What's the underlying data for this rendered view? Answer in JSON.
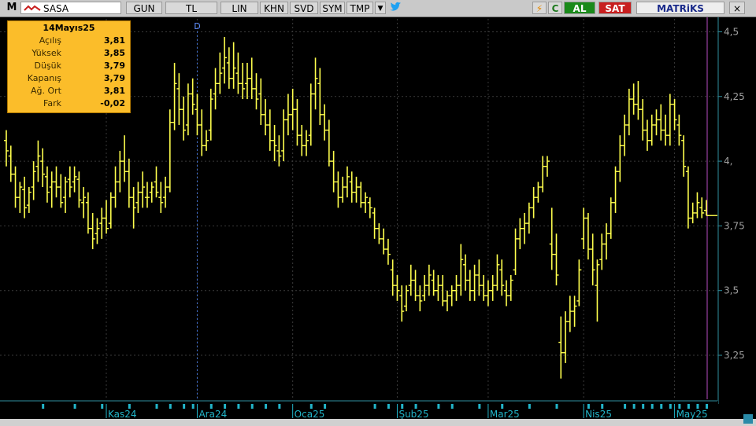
{
  "toolbar": {
    "m_label": "M",
    "symbol": "SASA",
    "gun": "GUN",
    "tl": "TL",
    "lin": "LIN",
    "khn": "KHN",
    "svd": "SVD",
    "sym": "SYM",
    "tmp": "TMP",
    "dropdown": "▼",
    "twitter_icon": "twitter-icon",
    "bolt_icon": "⚡",
    "refresh_label": "C",
    "al": "AL",
    "sat": "SAT",
    "matriks": "MATRiKS",
    "close": "×"
  },
  "info": {
    "date": "14Mayıs25",
    "rows": [
      {
        "label": "Açılış",
        "value": "3,81"
      },
      {
        "label": "Yüksek",
        "value": "3,85"
      },
      {
        "label": "Düşük",
        "value": "3,79"
      },
      {
        "label": "Kapanış",
        "value": "3,79"
      },
      {
        "label": "Ağ. Ort",
        "value": "3,81"
      },
      {
        "label": "Fark",
        "value": "-0,02"
      }
    ]
  },
  "colors": {
    "bar": "#ffff4d",
    "grid": "#3a3a3a",
    "axis_text": "#a0a0a0",
    "month_text": "#22b5c9",
    "marker": "#22b5c9",
    "cursor": "#b84dc2",
    "divider": "#2f8fa0"
  },
  "chart_data": {
    "type": "ohlc",
    "ylim": [
      3.08,
      4.55
    ],
    "yticks": [
      {
        "v": 4.5,
        "label": "4,5"
      },
      {
        "v": 4.25,
        "label": "4,25"
      },
      {
        "v": 4.0,
        "label": "4,"
      },
      {
        "v": 3.75,
        "label": "3,75"
      },
      {
        "v": 3.5,
        "label": "3,5"
      },
      {
        "v": 3.25,
        "label": "3,25"
      }
    ],
    "months": [
      {
        "label": "Kas24",
        "index": 22
      },
      {
        "label": "Ara24",
        "index": 42
      },
      {
        "label": "Oca25",
        "index": 63
      },
      {
        "label": "Şub25",
        "index": 86
      },
      {
        "label": "Mar25",
        "index": 106
      },
      {
        "label": "Nis25",
        "index": 127
      },
      {
        "label": "May25",
        "index": 147
      }
    ],
    "dividend_marker": {
      "label": "D",
      "index": 42
    },
    "markers": [
      8,
      15,
      21,
      27,
      33,
      36,
      39,
      41,
      45,
      48,
      51,
      54,
      57,
      60,
      67,
      70,
      81,
      84,
      87,
      90,
      95,
      98,
      104,
      109,
      115,
      121,
      128,
      131,
      136,
      138,
      140,
      142,
      144,
      146,
      148,
      150,
      152,
      154
    ],
    "ohlc": [
      [
        4.08,
        4.12,
        3.98,
        4.04
      ],
      [
        4.02,
        4.06,
        3.92,
        3.95
      ],
      [
        3.95,
        3.98,
        3.82,
        3.86
      ],
      [
        3.86,
        3.92,
        3.8,
        3.9
      ],
      [
        3.89,
        3.94,
        3.78,
        3.82
      ],
      [
        3.83,
        3.9,
        3.8,
        3.88
      ],
      [
        3.9,
        4.0,
        3.85,
        3.96
      ],
      [
        3.98,
        4.08,
        3.92,
        4.02
      ],
      [
        4.0,
        4.05,
        3.9,
        3.95
      ],
      [
        3.94,
        3.98,
        3.84,
        3.88
      ],
      [
        3.9,
        3.96,
        3.82,
        3.92
      ],
      [
        3.92,
        3.98,
        3.86,
        3.9
      ],
      [
        3.9,
        3.95,
        3.82,
        3.84
      ],
      [
        3.86,
        3.94,
        3.8,
        3.92
      ],
      [
        3.93,
        3.98,
        3.86,
        3.9
      ],
      [
        3.92,
        3.98,
        3.88,
        3.94
      ],
      [
        3.93,
        3.96,
        3.82,
        3.85
      ],
      [
        3.84,
        3.9,
        3.78,
        3.86
      ],
      [
        3.84,
        3.88,
        3.72,
        3.74
      ],
      [
        3.74,
        3.8,
        3.66,
        3.7
      ],
      [
        3.72,
        3.78,
        3.68,
        3.74
      ],
      [
        3.76,
        3.82,
        3.7,
        3.78
      ],
      [
        3.78,
        3.85,
        3.72,
        3.74
      ],
      [
        3.76,
        3.88,
        3.74,
        3.86
      ],
      [
        3.86,
        3.98,
        3.82,
        3.92
      ],
      [
        3.92,
        4.04,
        3.88,
        4.0
      ],
      [
        4.0,
        4.1,
        3.92,
        3.96
      ],
      [
        3.96,
        4.01,
        3.82,
        3.86
      ],
      [
        3.86,
        3.9,
        3.74,
        3.82
      ],
      [
        3.84,
        3.92,
        3.8,
        3.88
      ],
      [
        3.88,
        3.96,
        3.82,
        3.9
      ],
      [
        3.86,
        3.92,
        3.82,
        3.86
      ],
      [
        3.88,
        3.92,
        3.84,
        3.9
      ],
      [
        3.92,
        3.98,
        3.86,
        3.88
      ],
      [
        3.86,
        3.92,
        3.8,
        3.84
      ],
      [
        3.86,
        3.94,
        3.82,
        3.9
      ],
      [
        3.9,
        4.2,
        3.88,
        4.15
      ],
      [
        4.15,
        4.38,
        4.12,
        4.3
      ],
      [
        4.28,
        4.34,
        4.14,
        4.2
      ],
      [
        4.2,
        4.25,
        4.08,
        4.12
      ],
      [
        4.14,
        4.3,
        4.1,
        4.26
      ],
      [
        4.26,
        4.32,
        4.18,
        4.22
      ],
      [
        4.2,
        4.26,
        4.1,
        4.14
      ],
      [
        4.14,
        4.2,
        4.02,
        4.06
      ],
      [
        4.06,
        4.12,
        4.04,
        4.08
      ],
      [
        4.12,
        4.28,
        4.08,
        4.24
      ],
      [
        4.26,
        4.36,
        4.2,
        4.3
      ],
      [
        4.3,
        4.42,
        4.26,
        4.34
      ],
      [
        4.36,
        4.48,
        4.3,
        4.4
      ],
      [
        4.38,
        4.44,
        4.28,
        4.32
      ],
      [
        4.32,
        4.46,
        4.28,
        4.36
      ],
      [
        4.34,
        4.42,
        4.26,
        4.3
      ],
      [
        4.3,
        4.38,
        4.24,
        4.28
      ],
      [
        4.3,
        4.38,
        4.24,
        4.32
      ],
      [
        4.32,
        4.4,
        4.24,
        4.28
      ],
      [
        4.28,
        4.34,
        4.2,
        4.24
      ],
      [
        4.26,
        4.32,
        4.14,
        4.18
      ],
      [
        4.18,
        4.24,
        4.1,
        4.14
      ],
      [
        4.14,
        4.2,
        4.04,
        4.08
      ],
      [
        4.08,
        4.14,
        4.0,
        4.06
      ],
      [
        4.04,
        4.1,
        3.98,
        4.02
      ],
      [
        4.04,
        4.2,
        4.0,
        4.16
      ],
      [
        4.16,
        4.26,
        4.1,
        4.18
      ],
      [
        4.18,
        4.28,
        4.12,
        4.2
      ],
      [
        4.2,
        4.24,
        4.06,
        4.1
      ],
      [
        4.1,
        4.14,
        4.02,
        4.06
      ],
      [
        4.06,
        4.12,
        4.02,
        4.08
      ],
      [
        4.1,
        4.3,
        4.06,
        4.26
      ],
      [
        4.26,
        4.4,
        4.2,
        4.32
      ],
      [
        4.3,
        4.36,
        4.14,
        4.18
      ],
      [
        4.18,
        4.22,
        4.08,
        4.12
      ],
      [
        4.12,
        4.16,
        3.98,
        4.0
      ],
      [
        4.0,
        4.04,
        3.88,
        3.92
      ],
      [
        3.92,
        3.96,
        3.82,
        3.86
      ],
      [
        3.86,
        3.94,
        3.84,
        3.9
      ],
      [
        3.9,
        3.98,
        3.86,
        3.94
      ],
      [
        3.92,
        3.96,
        3.84,
        3.88
      ],
      [
        3.88,
        3.94,
        3.84,
        3.9
      ],
      [
        3.9,
        3.92,
        3.82,
        3.84
      ],
      [
        3.84,
        3.88,
        3.8,
        3.86
      ],
      [
        3.84,
        3.86,
        3.78,
        3.82
      ],
      [
        3.8,
        3.82,
        3.7,
        3.74
      ],
      [
        3.74,
        3.76,
        3.68,
        3.7
      ],
      [
        3.7,
        3.74,
        3.64,
        3.66
      ],
      [
        3.66,
        3.7,
        3.6,
        3.64
      ],
      [
        3.58,
        3.62,
        3.48,
        3.52
      ],
      [
        3.52,
        3.56,
        3.46,
        3.5
      ],
      [
        3.48,
        3.52,
        3.38,
        3.42
      ],
      [
        3.44,
        3.52,
        3.42,
        3.5
      ],
      [
        3.52,
        3.6,
        3.48,
        3.54
      ],
      [
        3.54,
        3.58,
        3.46,
        3.48
      ],
      [
        3.48,
        3.52,
        3.42,
        3.46
      ],
      [
        3.48,
        3.56,
        3.46,
        3.52
      ],
      [
        3.52,
        3.6,
        3.48,
        3.56
      ],
      [
        3.54,
        3.58,
        3.48,
        3.5
      ],
      [
        3.5,
        3.56,
        3.46,
        3.52
      ],
      [
        3.52,
        3.56,
        3.44,
        3.46
      ],
      [
        3.46,
        3.5,
        3.42,
        3.48
      ],
      [
        3.48,
        3.52,
        3.44,
        3.5
      ],
      [
        3.5,
        3.56,
        3.46,
        3.52
      ],
      [
        3.52,
        3.68,
        3.48,
        3.62
      ],
      [
        3.6,
        3.64,
        3.5,
        3.54
      ],
      [
        3.54,
        3.58,
        3.46,
        3.5
      ],
      [
        3.5,
        3.6,
        3.46,
        3.56
      ],
      [
        3.56,
        3.62,
        3.48,
        3.52
      ],
      [
        3.52,
        3.56,
        3.46,
        3.48
      ],
      [
        3.48,
        3.54,
        3.44,
        3.5
      ],
      [
        3.5,
        3.56,
        3.46,
        3.52
      ],
      [
        3.52,
        3.64,
        3.5,
        3.6
      ],
      [
        3.58,
        3.62,
        3.48,
        3.52
      ],
      [
        3.5,
        3.54,
        3.44,
        3.48
      ],
      [
        3.48,
        3.56,
        3.46,
        3.54
      ],
      [
        3.58,
        3.74,
        3.56,
        3.7
      ],
      [
        3.7,
        3.78,
        3.66,
        3.74
      ],
      [
        3.74,
        3.8,
        3.68,
        3.76
      ],
      [
        3.76,
        3.84,
        3.72,
        3.82
      ],
      [
        3.82,
        3.9,
        3.78,
        3.86
      ],
      [
        3.86,
        3.92,
        3.84,
        3.9
      ],
      [
        3.9,
        4.02,
        3.88,
        3.98
      ],
      [
        3.98,
        4.02,
        3.94,
        4.0
      ],
      [
        3.68,
        3.82,
        3.58,
        3.64
      ],
      [
        3.64,
        3.72,
        3.52,
        3.56
      ],
      [
        3.3,
        3.4,
        3.16,
        3.26
      ],
      [
        3.26,
        3.42,
        3.22,
        3.38
      ],
      [
        3.38,
        3.48,
        3.34,
        3.42
      ],
      [
        3.42,
        3.48,
        3.36,
        3.44
      ],
      [
        3.46,
        3.62,
        3.44,
        3.58
      ],
      [
        3.7,
        3.82,
        3.66,
        3.78
      ],
      [
        3.78,
        3.8,
        3.62,
        3.66
      ],
      [
        3.66,
        3.72,
        3.52,
        3.58
      ],
      [
        3.52,
        3.62,
        3.38,
        3.6
      ],
      [
        3.62,
        3.72,
        3.58,
        3.68
      ],
      [
        3.68,
        3.76,
        3.62,
        3.72
      ],
      [
        3.72,
        3.86,
        3.7,
        3.84
      ],
      [
        3.84,
        3.98,
        3.8,
        3.96
      ],
      [
        3.96,
        4.1,
        3.92,
        4.06
      ],
      [
        4.06,
        4.18,
        4.02,
        4.14
      ],
      [
        4.14,
        4.28,
        4.1,
        4.24
      ],
      [
        4.24,
        4.3,
        4.18,
        4.22
      ],
      [
        4.22,
        4.31,
        4.16,
        4.2
      ],
      [
        4.2,
        4.24,
        4.08,
        4.12
      ],
      [
        4.12,
        4.16,
        4.04,
        4.08
      ],
      [
        4.08,
        4.18,
        4.06,
        4.14
      ],
      [
        4.14,
        4.2,
        4.1,
        4.16
      ],
      [
        4.16,
        4.22,
        4.08,
        4.12
      ],
      [
        4.12,
        4.18,
        4.06,
        4.1
      ],
      [
        4.1,
        4.26,
        4.06,
        4.22
      ],
      [
        4.22,
        4.24,
        4.12,
        4.16
      ],
      [
        4.14,
        4.18,
        4.06,
        4.1
      ],
      [
        4.08,
        4.1,
        3.94,
        3.98
      ],
      [
        3.96,
        3.98,
        3.74,
        3.78
      ],
      [
        3.78,
        3.84,
        3.76,
        3.8
      ],
      [
        3.8,
        3.88,
        3.78,
        3.84
      ],
      [
        3.82,
        3.86,
        3.78,
        3.8
      ],
      [
        3.81,
        3.85,
        3.79,
        3.79
      ]
    ]
  }
}
